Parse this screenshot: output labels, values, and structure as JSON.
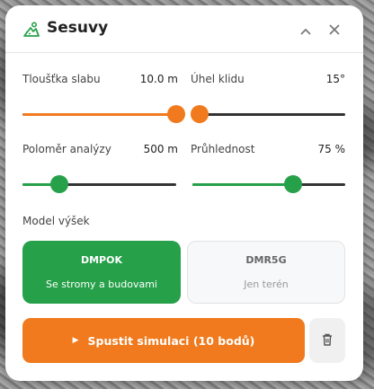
{
  "header": {
    "title": "Sesuvy",
    "logo_icon": "landslide-icon",
    "collapse_icon": "chevron-up-icon",
    "close_icon": "close-icon"
  },
  "sliders": [
    {
      "label": "Tloušťka slabu",
      "value": "10.0 m",
      "level": 1.0,
      "color": "#f07a1d"
    },
    {
      "label": "Úhel klidu",
      "value": "15°",
      "level": 0.0,
      "color": "#f07a1d"
    },
    {
      "label": "Poloměr analýzy",
      "value": "500 m",
      "level": 0.24,
      "color": "#27a04a"
    },
    {
      "label": "Průhlednost",
      "value": "75 %",
      "level": 0.66,
      "color": "#27a04a"
    }
  ],
  "model": {
    "label": "Model výšek",
    "options": [
      {
        "title": "DMPOK",
        "subtitle": "Se stromy a budovami",
        "selected": true
      },
      {
        "title": "DMR5G",
        "subtitle": "Jen terén",
        "selected": false
      }
    ]
  },
  "actions": {
    "run_label": "Spustit simulaci (10 bodů)",
    "run_icon": "play-icon",
    "delete_icon": "trash-icon"
  },
  "colors": {
    "accent_orange": "#f07a1d",
    "accent_green": "#27a04a",
    "track": "#333333"
  }
}
